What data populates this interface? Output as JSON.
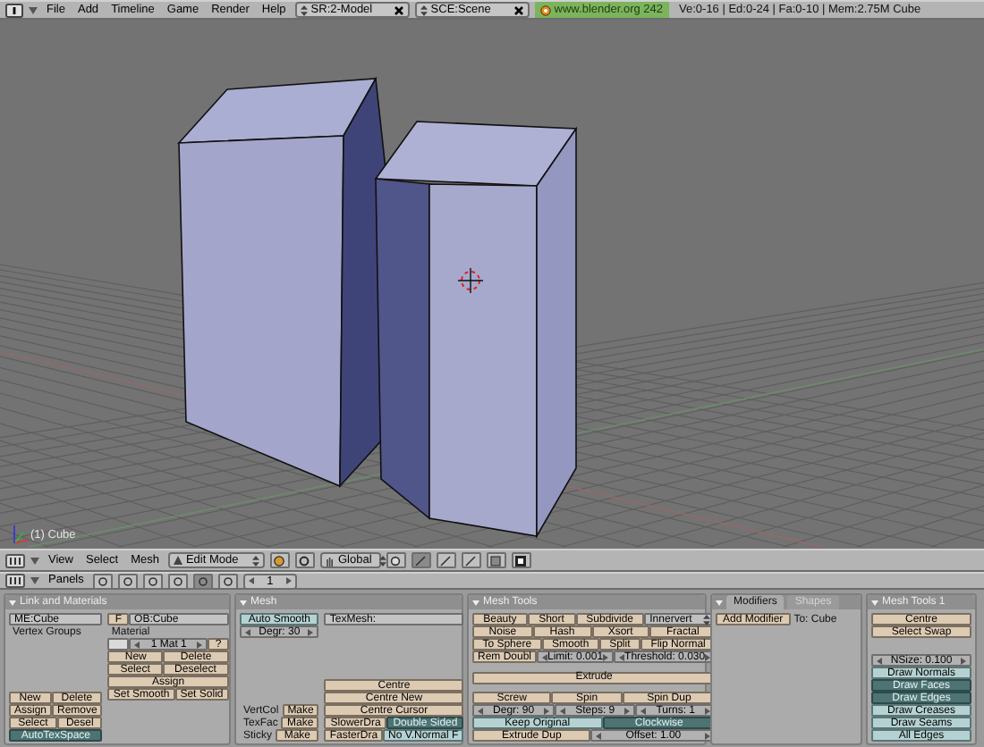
{
  "top_bar": {
    "menus": [
      "File",
      "Add",
      "Timeline",
      "Game",
      "Render",
      "Help"
    ],
    "screen": "SR:2-Model",
    "scene": "SCE:Scene",
    "version": "www.blender.org 242",
    "stats": "Ve:0-16 | Ed:0-24 | Fa:0-10 | Mem:2.75M Cube"
  },
  "viewport": {
    "object_label": "(1) Cube"
  },
  "view_header": {
    "menus": [
      "View",
      "Select",
      "Mesh"
    ],
    "mode": "Edit Mode",
    "orientation": "Global",
    "select_modes": [
      {
        "selected": true
      },
      {
        "selected": false
      },
      {
        "selected": false
      }
    ]
  },
  "buttons_header": {
    "label": "Panels",
    "tabs": [
      {
        "selected": false
      },
      {
        "selected": false
      },
      {
        "selected": false
      },
      {
        "selected": false
      },
      {
        "selected": true
      },
      {
        "selected": false
      }
    ],
    "page": "1"
  },
  "panels": [
    {
      "title": "Link and Materials",
      "columns": [
        [
          [
            [
              {
                "kind": "field",
                "label": "ME:Cube"
              }
            ],
            [
              {
                "kind": "label",
                "label": "Vertex Groups"
              }
            ]
          ],
          [
            [
              {
                "kind": "button",
                "label": "New"
              },
              {
                "kind": "button",
                "label": "Delete"
              }
            ],
            [
              {
                "kind": "button",
                "label": "Assign"
              },
              {
                "kind": "button",
                "label": "Remove"
              }
            ],
            [
              {
                "kind": "button",
                "label": "Select"
              },
              {
                "kind": "button",
                "label": "Desel"
              }
            ],
            [
              {
                "kind": "toggle",
                "label": "AutoTexSpace",
                "on": true
              }
            ]
          ]
        ],
        [
          [
            [
              {
                "kind": "small",
                "label": "F"
              },
              {
                "kind": "field",
                "label": "OB:Cube"
              }
            ],
            [
              {
                "kind": "label",
                "label": "Material"
              }
            ],
            [
              {
                "kind": "swatch"
              },
              {
                "kind": "number",
                "label": "1 Mat 1"
              },
              {
                "kind": "small",
                "label": "?"
              }
            ],
            [
              {
                "kind": "button",
                "label": "New"
              },
              {
                "kind": "button",
                "label": "Delete"
              }
            ],
            [
              {
                "kind": "button",
                "label": "Select"
              },
              {
                "kind": "button",
                "label": "Deselect"
              }
            ],
            [
              {
                "kind": "button",
                "label": "Assign"
              }
            ],
            [
              {
                "kind": "button",
                "label": "Set Smooth"
              },
              {
                "kind": "button",
                "label": "Set Solid"
              }
            ]
          ]
        ]
      ]
    },
    {
      "title": "Mesh",
      "columns": [
        [
          [
            [
              {
                "kind": "toggle",
                "label": "Auto Smooth",
                "on": false
              }
            ],
            [
              {
                "kind": "number",
                "label": "Degr: 30"
              }
            ]
          ],
          [
            [
              {
                "kind": "label",
                "label": "VertCol"
              },
              {
                "kind": "button",
                "label": "Make"
              }
            ],
            [
              {
                "kind": "label",
                "label": "TexFac"
              },
              {
                "kind": "button",
                "label": "Make"
              }
            ],
            [
              {
                "kind": "label",
                "label": "Sticky"
              },
              {
                "kind": "button",
                "label": "Make"
              }
            ]
          ]
        ],
        [
          [
            [
              {
                "kind": "field",
                "label": "TexMesh:"
              }
            ]
          ],
          [
            [
              {
                "kind": "button",
                "label": "Centre"
              }
            ],
            [
              {
                "kind": "button",
                "label": "Centre New"
              }
            ],
            [
              {
                "kind": "button",
                "label": "Centre Cursor"
              }
            ],
            [
              {
                "kind": "button",
                "label": "SlowerDra"
              },
              {
                "kind": "toggle",
                "label": "Double Sided",
                "on": true
              }
            ],
            [
              {
                "kind": "button",
                "label": "FasterDra"
              },
              {
                "kind": "toggle",
                "label": "No V.Normal F",
                "on": false
              }
            ]
          ]
        ]
      ]
    },
    {
      "title": "Mesh Tools",
      "columns": [
        [
          [
            [
              {
                "kind": "button",
                "label": "Beauty"
              },
              {
                "kind": "button",
                "label": "Short"
              },
              {
                "kind": "button",
                "label": "Subdivide"
              },
              {
                "kind": "menu",
                "label": "Innervert"
              }
            ],
            [
              {
                "kind": "button",
                "label": "Noise"
              },
              {
                "kind": "button",
                "label": "Hash"
              },
              {
                "kind": "button",
                "label": "Xsort"
              },
              {
                "kind": "button",
                "label": "Fractal"
              }
            ],
            [
              {
                "kind": "button",
                "label": "To Sphere"
              },
              {
                "kind": "button",
                "label": "Smooth"
              },
              {
                "kind": "button",
                "label": "Split"
              },
              {
                "kind": "button",
                "label": "Flip Normal"
              }
            ],
            [
              {
                "kind": "button",
                "label": "Rem Doubl"
              },
              {
                "kind": "number",
                "label": "Limit: 0.001"
              },
              {
                "kind": "number",
                "label": "Threshold: 0.030"
              }
            ]
          ],
          [
            [
              {
                "kind": "button",
                "label": "Extrude"
              }
            ]
          ],
          [
            [
              {
                "kind": "button",
                "label": "Screw"
              },
              {
                "kind": "button",
                "label": "Spin"
              },
              {
                "kind": "button",
                "label": "Spin Dup"
              }
            ],
            [
              {
                "kind": "number",
                "label": "Degr: 90"
              },
              {
                "kind": "number",
                "label": "Steps: 9"
              },
              {
                "kind": "number",
                "label": "Turns: 1"
              }
            ],
            [
              {
                "kind": "toggle",
                "label": "Keep Original",
                "on": false
              },
              {
                "kind": "toggle",
                "label": "Clockwise",
                "on": true
              }
            ],
            [
              {
                "kind": "button",
                "label": "Extrude Dup"
              },
              {
                "kind": "number",
                "label": "Offset: 1.00"
              }
            ]
          ]
        ]
      ]
    },
    {
      "tabs": [
        {
          "label": "Modifiers",
          "selected": true
        },
        {
          "label": "Shapes",
          "selected": false
        }
      ],
      "columns": [
        [
          [
            [
              {
                "kind": "small",
                "label": "Add Modifier"
              },
              {
                "kind": "label",
                "label": "To: Cube"
              }
            ]
          ]
        ]
      ]
    },
    {
      "title": "Mesh Tools 1",
      "columns": [
        [
          [
            [
              {
                "kind": "button",
                "label": "Centre"
              }
            ],
            [
              {
                "kind": "button",
                "label": "Select Swap"
              }
            ]
          ],
          [
            [
              {
                "kind": "number",
                "label": "NSize: 0.100"
              }
            ],
            [
              {
                "kind": "toggle",
                "label": "Draw Normals",
                "on": false
              }
            ],
            [
              {
                "kind": "toggle",
                "label": "Draw Faces",
                "on": true
              }
            ],
            [
              {
                "kind": "toggle",
                "label": "Draw Edges",
                "on": true
              }
            ],
            [
              {
                "kind": "toggle",
                "label": "Draw Creases",
                "on": false
              }
            ],
            [
              {
                "kind": "toggle",
                "label": "Draw Seams",
                "on": false
              }
            ],
            [
              {
                "kind": "toggle",
                "label": "All Edges",
                "on": false
              }
            ]
          ]
        ]
      ]
    }
  ]
}
